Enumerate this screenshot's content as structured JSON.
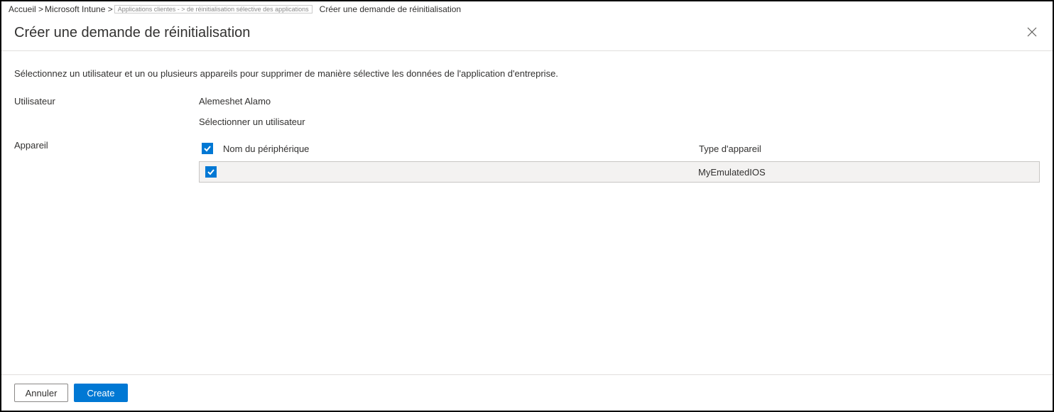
{
  "breadcrumb": {
    "items": [
      {
        "label": "Accueil >"
      },
      {
        "label": "Microsoft Intune >"
      },
      {
        "label": "Applications clientes - > de réinitialisation sélective des applications"
      },
      {
        "label": "Créer une demande de réinitialisation"
      }
    ]
  },
  "header": {
    "title": "Créer une demande de réinitialisation"
  },
  "description": "Sélectionnez un utilisateur et un ou plusieurs appareils pour supprimer de manière sélective les données de l'application d'entreprise.",
  "labels": {
    "user": "Utilisateur",
    "device": "Appareil"
  },
  "user": {
    "name": "Alemeshet Alamo",
    "select_link": "Sélectionner un utilisateur"
  },
  "device_table": {
    "columns": {
      "name": "Nom du périphérique",
      "type": "Type d'appareil"
    },
    "rows": [
      {
        "name": "",
        "type": "MyEmulatedIOS",
        "checked": true
      }
    ]
  },
  "footer": {
    "cancel": "Annuler",
    "create": "Create"
  }
}
